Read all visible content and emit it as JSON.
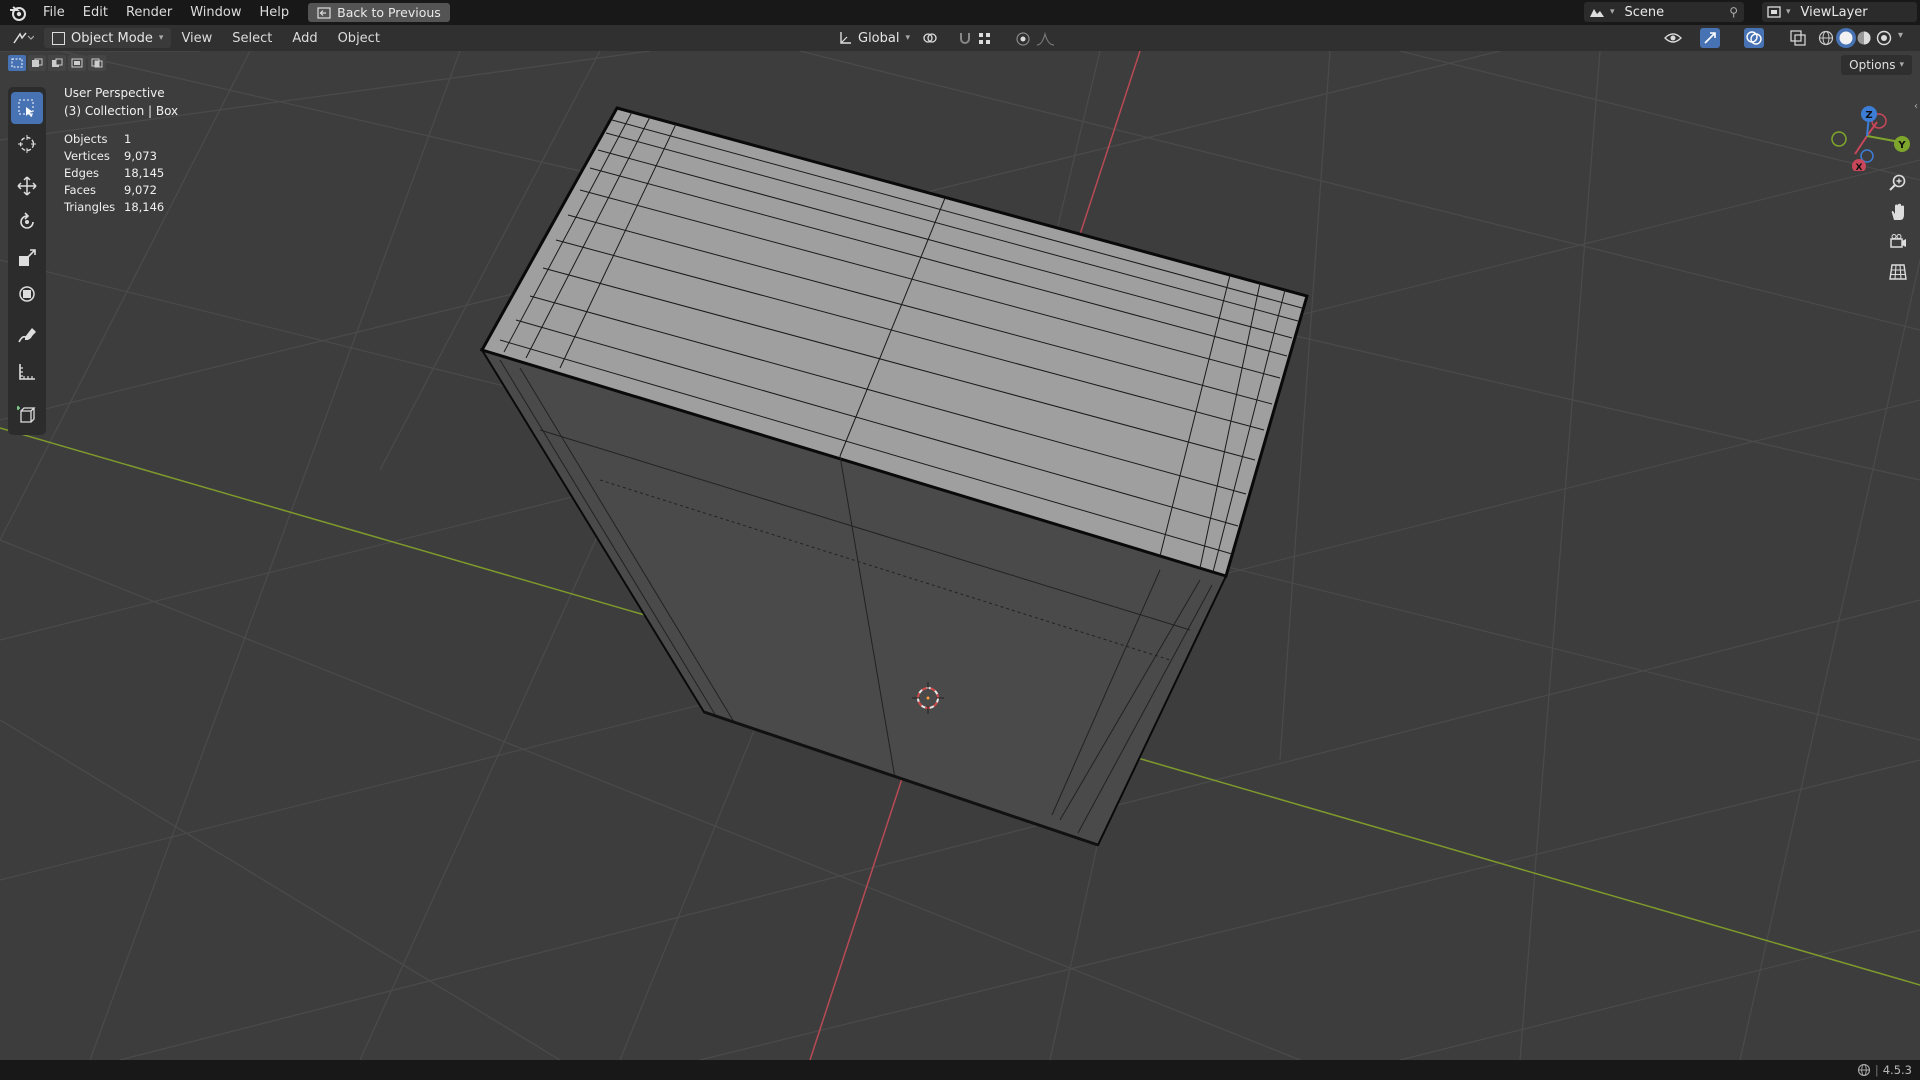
{
  "menu": {
    "file": "File",
    "edit": "Edit",
    "render": "Render",
    "window": "Window",
    "help": "Help",
    "back_button": "Back to Previous"
  },
  "scene": {
    "name": "Scene"
  },
  "view_layer": {
    "name": "ViewLayer"
  },
  "header": {
    "mode": "Object Mode",
    "view": "View",
    "select": "Select",
    "add": "Add",
    "object": "Object",
    "orientation": "Global",
    "options": "Options"
  },
  "overlay": {
    "perspective": "User Perspective",
    "collection": "(3) Collection | Box",
    "stats": [
      {
        "label": "Objects",
        "value": "1"
      },
      {
        "label": "Vertices",
        "value": "9,073"
      },
      {
        "label": "Edges",
        "value": "18,145"
      },
      {
        "label": "Faces",
        "value": "9,072"
      },
      {
        "label": "Triangles",
        "value": "18,146"
      }
    ]
  },
  "gizmo": {
    "x": "X",
    "y": "Y",
    "z": "Z"
  },
  "status": {
    "version": "4.5.3"
  },
  "colors": {
    "x_axis": "#c8475a",
    "y_axis": "#7fa62c",
    "z_axis": "#3c7dd6",
    "active_tool": "#4772b3"
  },
  "icons": {
    "tools": [
      "select-box-icon",
      "cursor-icon",
      "move-icon",
      "rotate-icon",
      "scale-icon",
      "transform-icon",
      "annotate-icon",
      "measure-icon",
      "add-cube-icon"
    ],
    "nav": [
      "zoom-icon",
      "pan-hand-icon",
      "camera-icon",
      "grid-view-icon"
    ]
  }
}
